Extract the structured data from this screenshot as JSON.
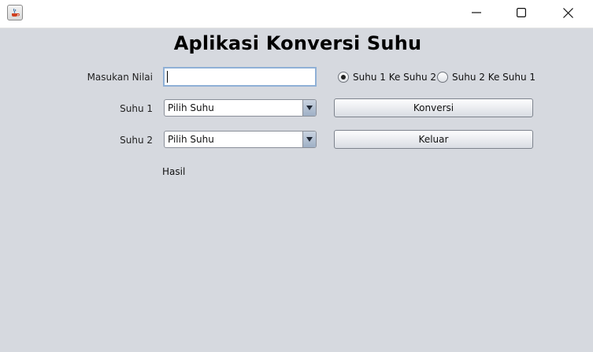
{
  "window": {
    "icon": "java-icon",
    "controls": [
      "minimize-icon",
      "maximize-icon",
      "close-icon"
    ]
  },
  "app": {
    "title": "Aplikasi Konversi Suhu"
  },
  "form": {
    "nilai_label": "Masukan Nilai",
    "nilai_value": "",
    "radio_options": [
      {
        "label": "Suhu 1 Ke Suhu 2",
        "selected": true
      },
      {
        "label": "Suhu 2 Ke Suhu 1",
        "selected": false
      }
    ],
    "suhu1_label": "Suhu 1",
    "suhu1_selected": "Pilih Suhu",
    "suhu2_label": "Suhu 2",
    "suhu2_selected": "Pilih Suhu",
    "konversi_label": "Konversi",
    "keluar_label": "Keluar",
    "hasil_label": "Hasil"
  },
  "colors": {
    "background": "#d6d9df",
    "input_focus_border": "#8fb0d6"
  }
}
